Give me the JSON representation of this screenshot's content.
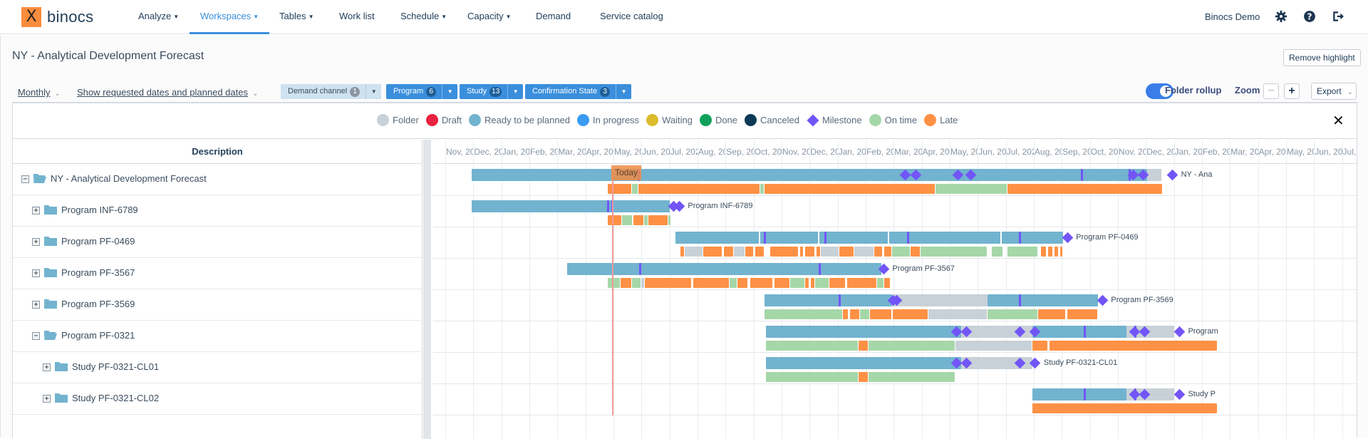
{
  "nav": {
    "logo_mark": "X",
    "logo_text": "binocs",
    "items": [
      {
        "label": "Analyze",
        "dropdown": true,
        "active": false
      },
      {
        "label": "Workspaces",
        "dropdown": true,
        "active": true
      },
      {
        "label": "Tables",
        "dropdown": true,
        "active": false
      },
      {
        "label": "Work list",
        "dropdown": false,
        "active": false
      },
      {
        "label": "Schedule",
        "dropdown": true,
        "active": false
      },
      {
        "label": "Capacity",
        "dropdown": true,
        "active": false
      },
      {
        "label": "Demand",
        "dropdown": false,
        "active": false
      },
      {
        "label": "Service catalog",
        "dropdown": false,
        "active": false
      }
    ],
    "user": "Binocs Demo",
    "icons": [
      "gear-icon",
      "help-icon",
      "logout-icon"
    ]
  },
  "page": {
    "title": "NY - Analytical Development Forecast",
    "remove_highlight": "Remove highlight"
  },
  "toolbar": {
    "period": "Monthly",
    "date_mode": "Show requested dates and planned dates",
    "filters": [
      {
        "label": "Demand channel",
        "count": "1",
        "muted": true
      },
      {
        "label": "Program",
        "count": "6",
        "muted": false
      },
      {
        "label": "Study",
        "count": "13",
        "muted": false
      },
      {
        "label": "Confirmation State",
        "count": "3",
        "muted": false
      }
    ],
    "folder_rollup_label": "Folder rollup",
    "folder_rollup_on": true,
    "zoom_label": "Zoom",
    "zoom_out": "−",
    "zoom_in": "+",
    "export_label": "Export"
  },
  "legend": {
    "items": [
      {
        "label": "Folder",
        "color": "#c8d1d7",
        "shape": "dot"
      },
      {
        "label": "Draft",
        "color": "#e8233f",
        "shape": "dot"
      },
      {
        "label": "Ready to be planned",
        "color": "#72b3cf",
        "shape": "dot"
      },
      {
        "label": "In progress",
        "color": "#3a9bf2",
        "shape": "dot"
      },
      {
        "label": "Waiting",
        "color": "#dcbb2c",
        "shape": "dot"
      },
      {
        "label": "Done",
        "color": "#10a05a",
        "shape": "dot"
      },
      {
        "label": "Canceled",
        "color": "#0a3a55",
        "shape": "dot"
      },
      {
        "label": "Milestone",
        "color": "#7255f7",
        "shape": "diamond"
      },
      {
        "label": "On time",
        "color": "#a6d7a8",
        "shape": "dot"
      },
      {
        "label": "Late",
        "color": "#fe9145",
        "shape": "dot"
      }
    ],
    "close": "✕"
  },
  "tree": {
    "header": "Description",
    "rows": [
      {
        "label": "NY - Analytical Development Forecast",
        "level": 0,
        "expanded": true
      },
      {
        "label": "Program INF-6789",
        "level": 1,
        "expanded": false
      },
      {
        "label": "Program PF-0469",
        "level": 1,
        "expanded": false
      },
      {
        "label": "Program PF-3567",
        "level": 1,
        "expanded": false
      },
      {
        "label": "Program PF-3569",
        "level": 1,
        "expanded": false
      },
      {
        "label": "Program PF-0321",
        "level": 1,
        "expanded": true
      },
      {
        "label": "Study PF-0321-CL01",
        "level": 2,
        "expanded": false
      },
      {
        "label": "Study PF-0321-CL02",
        "level": 2,
        "expanded": false
      }
    ]
  },
  "chart_data": {
    "type": "gantt",
    "months": [
      "Nov, 20",
      "Dec, 20",
      "Jan, 20",
      "Feb, 20",
      "Mar, 20",
      "Apr, 20",
      "May, 20",
      "Jun, 20",
      "Jul, 202",
      "Aug, 20",
      "Sep, 20",
      "Oct, 20",
      "Nov, 20",
      "Dec, 20",
      "Jan, 20",
      "Feb, 20",
      "Mar, 20",
      "Apr, 20",
      "May, 20",
      "Jun, 20",
      "Jul, 202",
      "Aug, 20",
      "Sep, 20",
      "Oct, 20",
      "Nov, 20",
      "Dec, 20",
      "Jan, 20",
      "Feb, 20",
      "Mar, 20",
      "Apr, 20",
      "May, 20",
      "Jun, 20",
      "Jul, 202"
    ],
    "today": {
      "label": "Today",
      "month": 5.95
    },
    "colors": {
      "ready": "#72b3cf",
      "folder": "#c8d1d7",
      "late": "#fe9145",
      "ontime": "#a6d7a8",
      "milestone": "#7255f7"
    },
    "rows": [
      {
        "label": "NY - Ana",
        "plan": [
          [
            "ready",
            0.93,
            25.05
          ],
          [
            "folder",
            25.05,
            25.55
          ]
        ],
        "status": [
          [
            "late",
            5.8,
            6.65
          ],
          [
            "ontime",
            6.65,
            6.9
          ],
          [
            "late",
            6.9,
            11.25
          ],
          [
            "ontime",
            11.25,
            11.4
          ],
          [
            "late",
            11.4,
            17.5
          ],
          [
            "ontime",
            17.5,
            20.05
          ],
          [
            "late",
            20.05,
            25.6
          ]
        ],
        "milestones": [
          16.4,
          16.8,
          18.3,
          18.75,
          24.55,
          24.9,
          25.95
        ],
        "ticks": [
          6.9,
          22.7,
          24.4
        ]
      },
      {
        "label": "Program INF-6789",
        "plan": [
          [
            "ready",
            0.93,
            8.0
          ]
        ],
        "status": [
          [
            "late",
            5.8,
            6.3
          ],
          [
            "ontime",
            6.3,
            6.7
          ],
          [
            "late",
            6.7,
            7.1
          ],
          [
            "ontime",
            7.1,
            7.25
          ],
          [
            "late",
            7.25,
            7.95
          ],
          [
            "ontime",
            7.95,
            8.05
          ]
        ],
        "milestones": [
          8.15,
          8.35
        ],
        "ticks": [
          5.8,
          5.95
        ]
      },
      {
        "label": "Program PF-0469",
        "plan": [
          [
            "ready",
            8.2,
            11.2
          ],
          [
            "ready",
            11.25,
            13.3
          ],
          [
            "ready",
            13.35,
            15.8
          ],
          [
            "ready",
            15.85,
            19.8
          ],
          [
            "ready",
            19.85,
            22.05
          ]
        ],
        "status": [
          [
            "late",
            8.4,
            8.55
          ],
          [
            "folder",
            8.55,
            9.2
          ],
          [
            "late",
            9.2,
            9.9
          ],
          [
            "late",
            9.93,
            10.3
          ],
          [
            "folder",
            10.3,
            10.7
          ],
          [
            "late",
            10.7,
            11.0
          ],
          [
            "late",
            11.05,
            11.4
          ],
          [
            "late",
            11.6,
            12.6
          ],
          [
            "late",
            12.65,
            12.8
          ],
          [
            "late",
            12.85,
            13.2
          ],
          [
            "late",
            13.25,
            13.4
          ],
          [
            "folder",
            13.4,
            14.05
          ],
          [
            "late",
            14.05,
            14.6
          ],
          [
            "folder",
            14.6,
            15.3
          ],
          [
            "late",
            15.3,
            15.6
          ],
          [
            "late",
            15.65,
            15.95
          ],
          [
            "ontime",
            15.95,
            16.6
          ],
          [
            "late",
            16.6,
            16.95
          ],
          [
            "ontime",
            16.95,
            19.35
          ],
          [
            "ontime",
            19.5,
            19.9
          ],
          [
            "ontime",
            20.05,
            21.15
          ],
          [
            "late",
            21.25,
            21.45
          ],
          [
            "late",
            21.5,
            21.7
          ],
          [
            "late",
            21.75,
            21.9
          ],
          [
            "late",
            21.95,
            22.05
          ]
        ],
        "milestones": [
          22.2
        ],
        "ticks": [
          11.4,
          13.55,
          16.5,
          20.5
        ]
      },
      {
        "label": "Program PF-3567",
        "plan": [
          [
            "ready",
            4.35,
            15.55
          ]
        ],
        "status": [
          [
            "ontime",
            5.8,
            6.25
          ],
          [
            "late",
            6.25,
            6.65
          ],
          [
            "ontime",
            6.65,
            6.98
          ],
          [
            "folder",
            6.98,
            7.13
          ],
          [
            "late",
            7.13,
            8.8
          ],
          [
            "late",
            8.85,
            10.15
          ],
          [
            "ontime",
            10.15,
            10.42
          ],
          [
            "late",
            10.42,
            10.8
          ],
          [
            "late",
            10.88,
            11.7
          ],
          [
            "late",
            11.75,
            12.3
          ],
          [
            "ontime",
            12.3,
            12.85
          ],
          [
            "late",
            12.85,
            13.0
          ],
          [
            "late",
            13.05,
            13.2
          ],
          [
            "ontime",
            13.2,
            13.7
          ],
          [
            "late",
            13.7,
            14.3
          ],
          [
            "late",
            14.35,
            15.4
          ],
          [
            "ontime",
            15.4,
            15.65
          ],
          [
            "late",
            15.65,
            15.9
          ]
        ],
        "milestones": [
          15.65
        ],
        "ticks": [
          6.95,
          13.35
        ]
      },
      {
        "label": "Program PF-3569",
        "plan": [
          [
            "ready",
            11.4,
            15.95
          ],
          [
            "folder",
            15.95,
            19.35
          ],
          [
            "ready",
            19.35,
            23.3
          ]
        ],
        "status": [
          [
            "ontime",
            11.4,
            14.2
          ],
          [
            "late",
            14.2,
            14.4
          ],
          [
            "late",
            14.45,
            14.8
          ],
          [
            "ontime",
            14.8,
            15.15
          ],
          [
            "late",
            15.15,
            15.95
          ],
          [
            "late",
            15.98,
            17.25
          ],
          [
            "folder",
            17.25,
            19.35
          ],
          [
            "ontime",
            19.35,
            21.15
          ],
          [
            "late",
            21.15,
            22.15
          ],
          [
            "late",
            22.2,
            23.3
          ]
        ],
        "milestones": [
          15.98,
          16.1,
          23.45
        ],
        "ticks": [
          14.05,
          20.5
        ]
      },
      {
        "label": "Program",
        "plan": [
          [
            "ready",
            11.45,
            18.4
          ],
          [
            "folder",
            18.4,
            20.95
          ],
          [
            "ready",
            20.95,
            24.3
          ],
          [
            "folder",
            24.3,
            26.0
          ]
        ],
        "status": [
          [
            "ontime",
            11.45,
            14.75
          ],
          [
            "late",
            14.75,
            15.1
          ],
          [
            "ontime",
            15.1,
            18.2
          ],
          [
            "folder",
            18.2,
            20.95
          ],
          [
            "late",
            20.95,
            21.5
          ],
          [
            "late",
            21.55,
            27.55
          ]
        ],
        "milestones": [
          18.25,
          18.6,
          20.5,
          21.05,
          24.6,
          24.95,
          26.2
        ],
        "ticks": [
          22.8,
          24.6
        ]
      },
      {
        "label": "Study PF-0321-CL01",
        "plan": [
          [
            "ready",
            11.45,
            18.4
          ],
          [
            "folder",
            18.4,
            20.95
          ]
        ],
        "status": [
          [
            "ontime",
            11.45,
            14.75
          ],
          [
            "late",
            14.75,
            15.1
          ],
          [
            "ontime",
            15.1,
            18.2
          ]
        ],
        "milestones": [
          18.25,
          18.6,
          20.5,
          21.05
        ],
        "ticks": []
      },
      {
        "label": "Study P",
        "plan": [
          [
            "ready",
            20.95,
            24.3
          ],
          [
            "folder",
            24.3,
            26.0
          ]
        ],
        "status": [
          [
            "late",
            20.95,
            27.55
          ]
        ],
        "milestones": [
          24.6,
          24.95,
          26.2
        ],
        "ticks": [
          22.8,
          24.6
        ]
      }
    ]
  }
}
